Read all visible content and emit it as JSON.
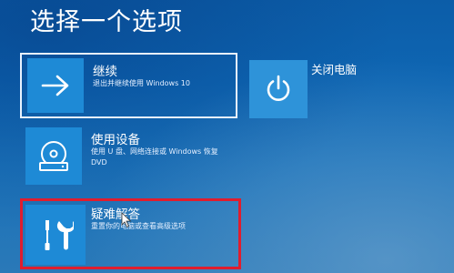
{
  "page": {
    "title": "选择一个选项"
  },
  "options": {
    "continue": {
      "title": "继续",
      "description": "退出并继续使用 Windows 10",
      "icon": "arrow-right-icon"
    },
    "use_device": {
      "title": "使用设备",
      "description_line1": "使用 U 盘、网络连接或 Windows 恢复",
      "description_line2": "DVD",
      "icon": "disc-drive-icon"
    },
    "troubleshoot": {
      "title": "疑难解答",
      "description": "重置你的电脑或查看高级选项",
      "icon": "wrench-screwdriver-icon",
      "highlight_color": "#e01d2e"
    },
    "shutdown": {
      "title": "关闭电脑",
      "icon": "power-icon"
    }
  },
  "colors": {
    "background": "#0e66b3",
    "tile_icon": "#1e8ad6",
    "highlight_border": "#e01d2e"
  }
}
